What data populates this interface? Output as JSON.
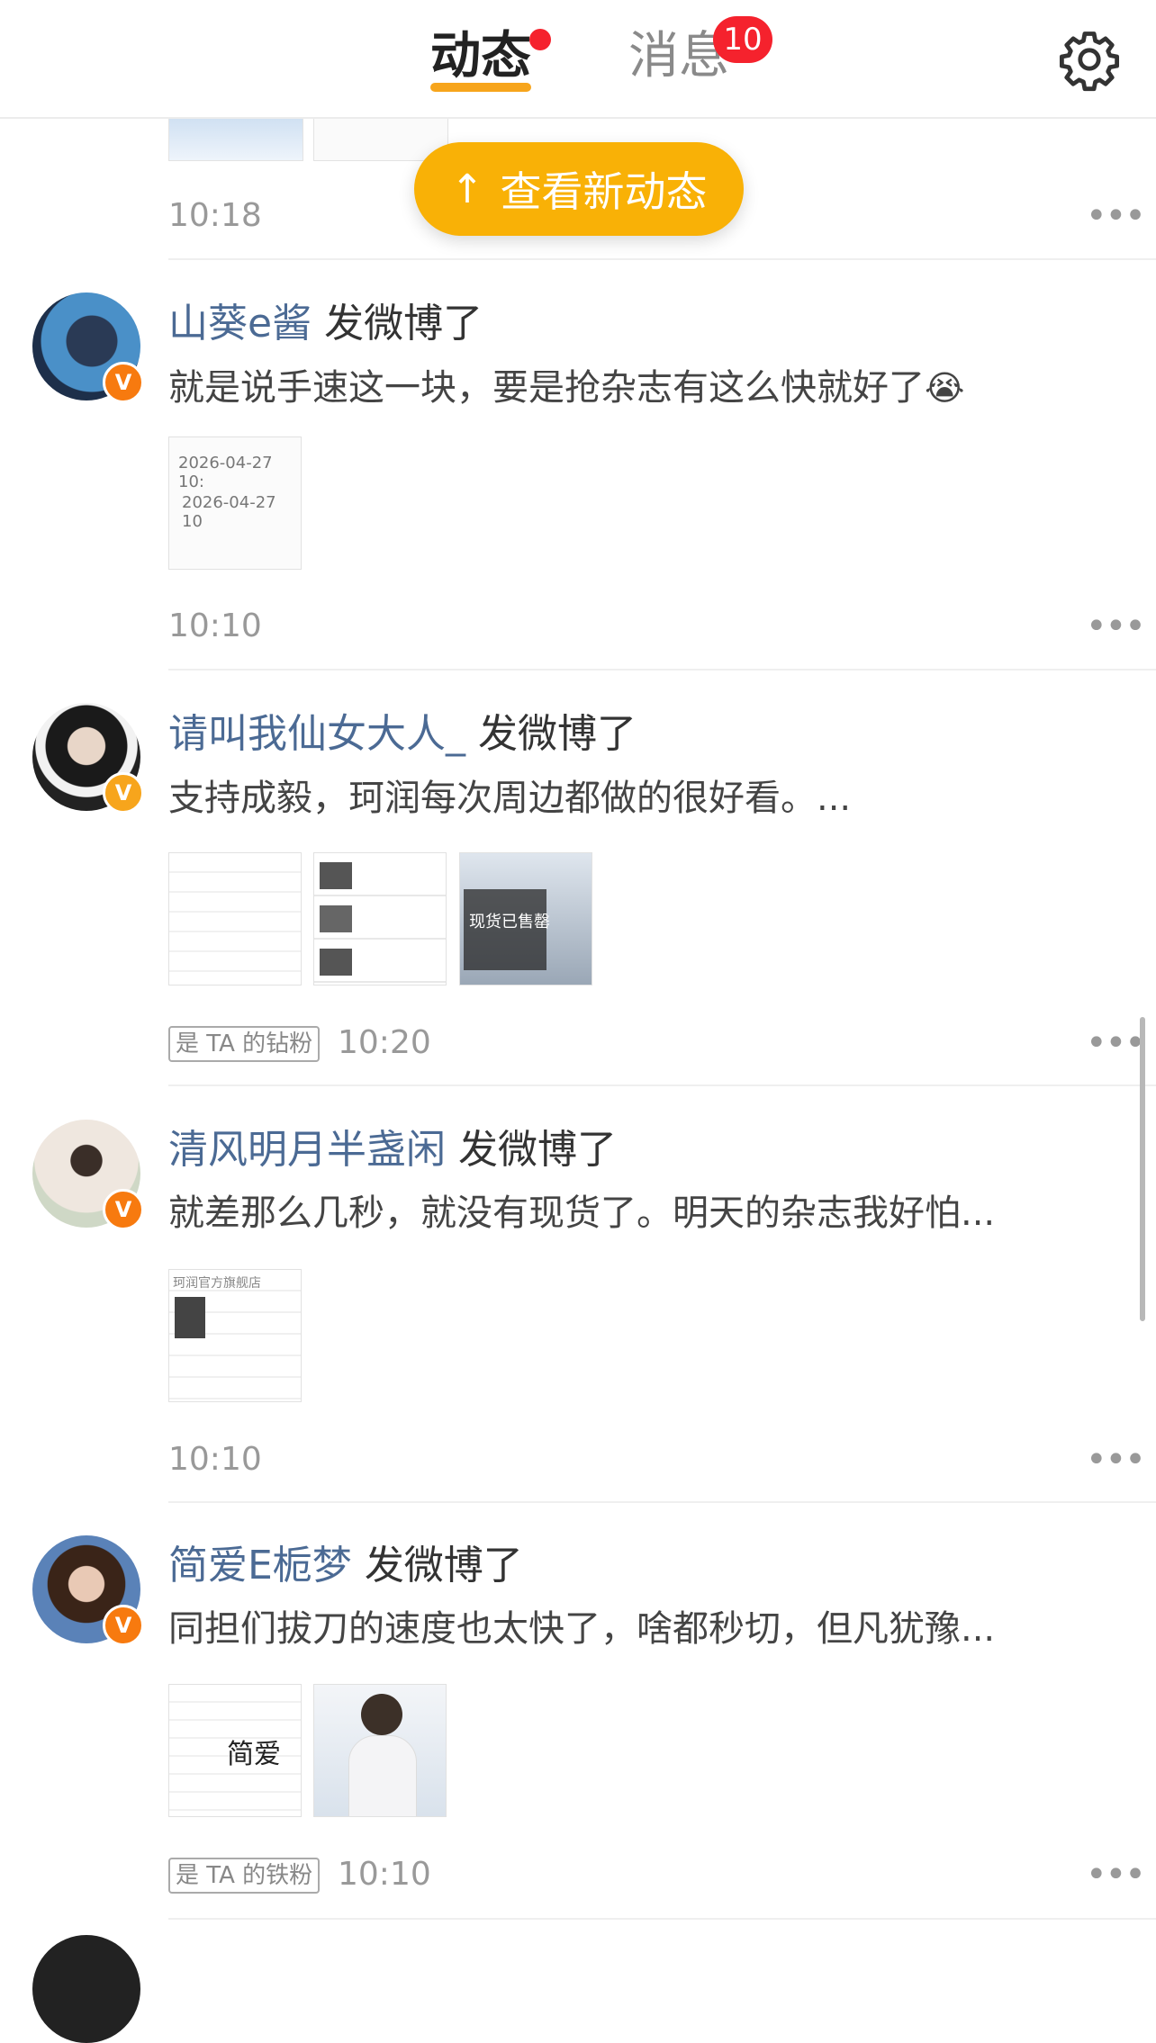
{
  "header": {
    "tab_feed": "动态",
    "tab_messages": "消息",
    "messages_badge": "10",
    "settings_icon": "gear-icon"
  },
  "new_posts_pill": {
    "arrow_icon": "arrow-up-icon",
    "label": "查看新动态"
  },
  "partial_post": {
    "time": "10:18"
  },
  "posts": [
    {
      "username": "山葵e酱",
      "action": "发微博了",
      "text": "就是说手速这一块，要是抢杂志有这么快就好了",
      "emoji": "😭",
      "thumb_texts": [
        "2026-04-27 10:",
        "2026-04-27 10"
      ],
      "time": "10:10",
      "fan_tag": ""
    },
    {
      "username": "请叫我仙女大人_",
      "action": "发微博了",
      "text": "支持成毅，珂润每次周边都做的很好看。...",
      "thumb_texts": [
        "",
        "",
        "现货已售罄"
      ],
      "time": "10:20",
      "fan_tag": "是 TA 的钻粉"
    },
    {
      "username": "清风明月半盏闲",
      "action": "发微博了",
      "text": "就差那么几秒，就没有现货了。明天的杂志我好怕...",
      "thumb_texts": [
        "珂润官方旗舰店"
      ],
      "time": "10:10",
      "fan_tag": ""
    },
    {
      "username": "简爱E栀梦",
      "action": "发微博了",
      "text": "同担们拔刀的速度也太快了，啥都秒切，但凡犹豫...",
      "thumb_texts": [
        "简爱",
        ""
      ],
      "time": "10:10",
      "fan_tag": "是 TA 的铁粉"
    }
  ],
  "more_icon": "more-dots-icon",
  "colors": {
    "accent": "#f7a51c",
    "badge_red": "#f5222d",
    "username_blue": "#4b6a94",
    "verified_orange": "#f77a0f"
  }
}
